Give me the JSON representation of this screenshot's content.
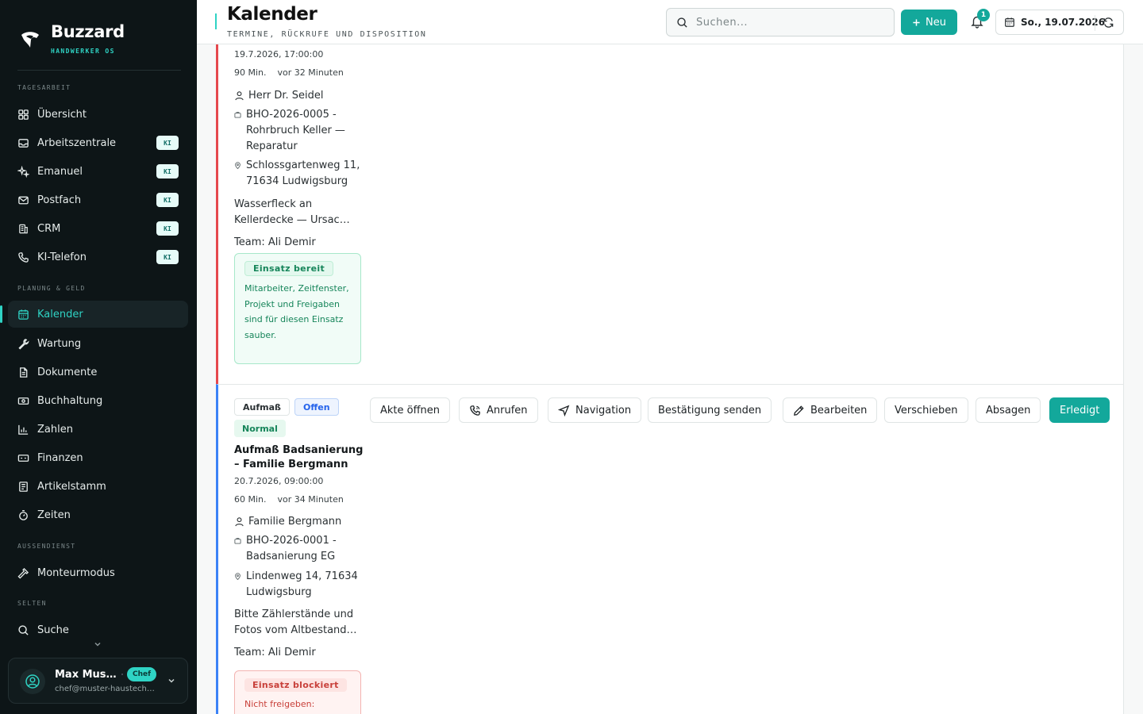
{
  "brand": {
    "name": "Buzzard",
    "subtitle": "HANDWERKER OS"
  },
  "sidebar": {
    "sections": {
      "tagesarbeit": "TAGESARBEIT",
      "planung": "PLANUNG & GELD",
      "aussendienst": "AUSSENDIENST",
      "selten": "SELTEN"
    },
    "items": [
      {
        "label": "Übersicht"
      },
      {
        "label": "Arbeitszentrale",
        "badge": "KI"
      },
      {
        "label": "Emanuel",
        "badge": "KI"
      },
      {
        "label": "Postfach",
        "badge": "KI"
      },
      {
        "label": "CRM",
        "badge": "KI"
      },
      {
        "label": "KI-Telefon",
        "badge": "KI"
      },
      {
        "label": "Kalender"
      },
      {
        "label": "Wartung"
      },
      {
        "label": "Dokumente"
      },
      {
        "label": "Buchhaltung"
      },
      {
        "label": "Zahlen"
      },
      {
        "label": "Finanzen"
      },
      {
        "label": "Artikelstamm"
      },
      {
        "label": "Zeiten"
      },
      {
        "label": "Monteurmodus"
      },
      {
        "label": "Suche"
      }
    ],
    "active_item": "Kalender",
    "user": {
      "name": "Max Mustermann",
      "email": "chef@muster-haustechnik.de",
      "role": "Chef"
    }
  },
  "header": {
    "title": "Kalender",
    "subtitle": "TERMINE, RÜCKRUFE UND DISPOSITION",
    "search_placeholder": "Suchen...",
    "new_label": "Neu",
    "notifications": "1",
    "date": "So., 19.07.2026"
  },
  "appointments": [
    {
      "datetime": "19.7.2026, 17:00:00",
      "duration": "90 Min.",
      "relative": "vor 32 Minuten",
      "customer": "Herr Dr. Seidel",
      "project": "BHO-2026-0005 - Rohrbruch Keller — Reparatur",
      "address": "Schlossgartenweg 11, 71634 Ludwigsburg",
      "note": "Wasserfleck an Kellerdecke — Ursache unklar",
      "team": "Team: Ali Demir",
      "status_label": "Einsatz bereit",
      "status_text": "Mitarbeiter, Zeitfenster, Projekt und Freigaben sind für diesen Einsatz sauber."
    },
    {
      "type": "Aufmaß",
      "state": "Offen",
      "priority": "Normal",
      "title": "Aufmaß Badsanierung – Familie Bergmann",
      "datetime": "20.7.2026, 09:00:00",
      "duration": "60 Min.",
      "relative": "vor 34 Minuten",
      "customer": "Familie Bergmann",
      "project": "BHO-2026-0001 - Badsanierung EG",
      "address": "Lindenweg 14, 71634 Ludwigsburg",
      "note": "Bitte Zählerstände und Fotos vom Altbestand machen",
      "team": "Team: Ali Demir",
      "status_label": "Einsatz blockiert",
      "status_text": "Nicht freigeben:",
      "actions": {
        "open": "Akte öffnen",
        "call": "Anrufen",
        "navigate": "Navigation",
        "confirm": "Bestätigung senden",
        "edit": "Bearbeiten",
        "move": "Verschieben",
        "cancel": "Absagen",
        "done": "Erledigt"
      }
    }
  ],
  "colors": {
    "accent": "#13a89b",
    "sidebar_bg": "#0d1517",
    "card_red": "#e5484d",
    "card_blue": "#3b82f6"
  }
}
